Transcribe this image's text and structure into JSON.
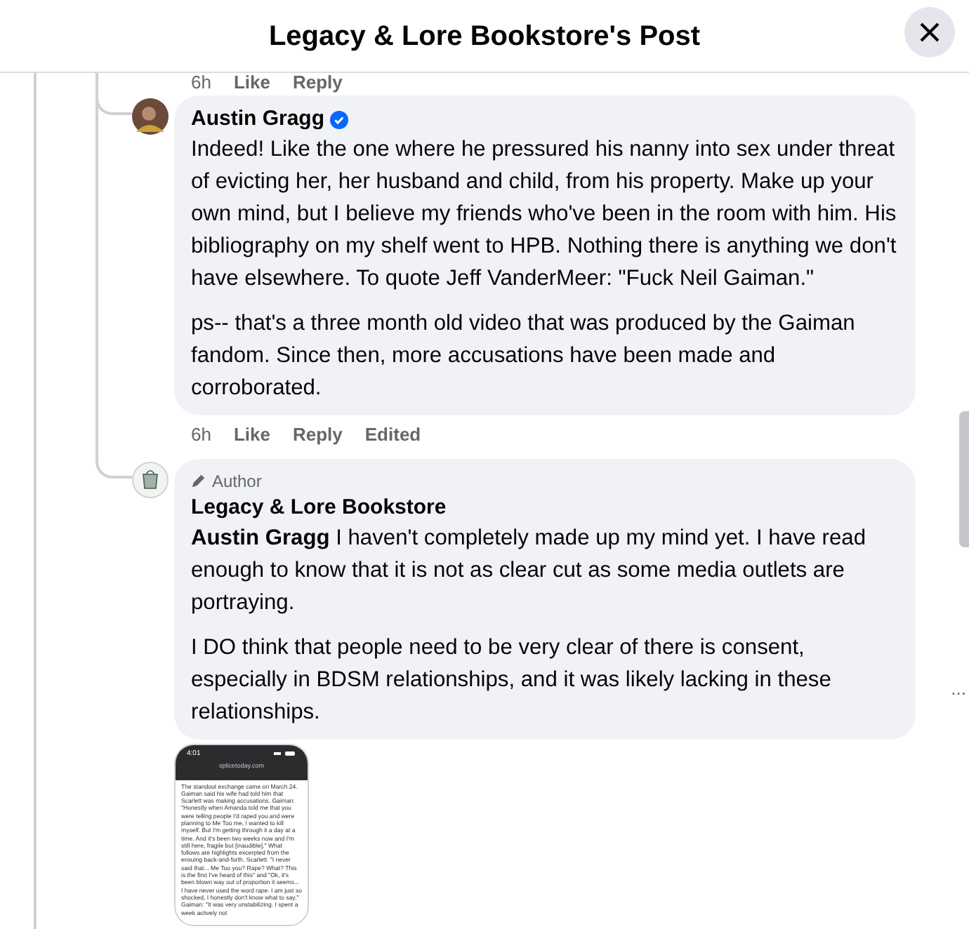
{
  "header": {
    "title": "Legacy & Lore Bookstore's Post"
  },
  "previous_actions": [
    "6h",
    "Like",
    "Reply"
  ],
  "comments": [
    {
      "kind": "reply",
      "author": "Austin Gragg",
      "verified": true,
      "paragraphs": [
        "Indeed! Like the one where he pressured his nanny into sex under threat of evicting her, her husband and child, from his property. Make up your own mind, but I believe my friends who've been in the room with him. His bibliography on my shelf went to HPB. Nothing there is anything we don't have elsewhere. To quote Jeff VanderMeer: \"Fuck Neil Gaiman.\"",
        "ps-- that's a three month old video that was produced by the Gaiman fandom. Since then, more accusations have been made and corroborated."
      ],
      "actions": [
        "6h",
        "Like",
        "Reply",
        "Edited"
      ]
    },
    {
      "kind": "author_reply",
      "badge": "Author",
      "author": "Legacy & Lore Bookstore",
      "verified": false,
      "paragraphs": [
        "**Austin Gragg** I haven't completely made up my mind yet. I have read enough to know that it is not as clear cut as some media outlets are portraying.",
        "I DO think that people need to be very clear of there is consent, especially in BDSM relationships, and it was likely lacking in these relationships."
      ],
      "more": "...",
      "attachment": {
        "status_time": "4:01",
        "url": "splicetoday.com",
        "text": "The standout exchange came on March 24. Gaiman said his wife had told him that Scarlett was making accusations. Gaiman: \"Honestly when Amanda told me that you were telling people I'd raped you and were planning to Me Too me, I wanted to kill myself. But I'm getting through it a day at a time. And it's been two weeks now and I'm still here, fragile but [inaudible].\" What follows are highlights excerpted from the ensuing back-and-forth. Scarlett: \"I never said that... Me Too you? Rape? What? This is the first I've heard of this\" and \"Ok, it's been blown way out of proportion it seems... I have never used the word rape. I am just so shocked, I honestly don't know what to say.\" Gaiman: \"It was very unstabilizing. I spent a week actively not"
      }
    }
  ]
}
